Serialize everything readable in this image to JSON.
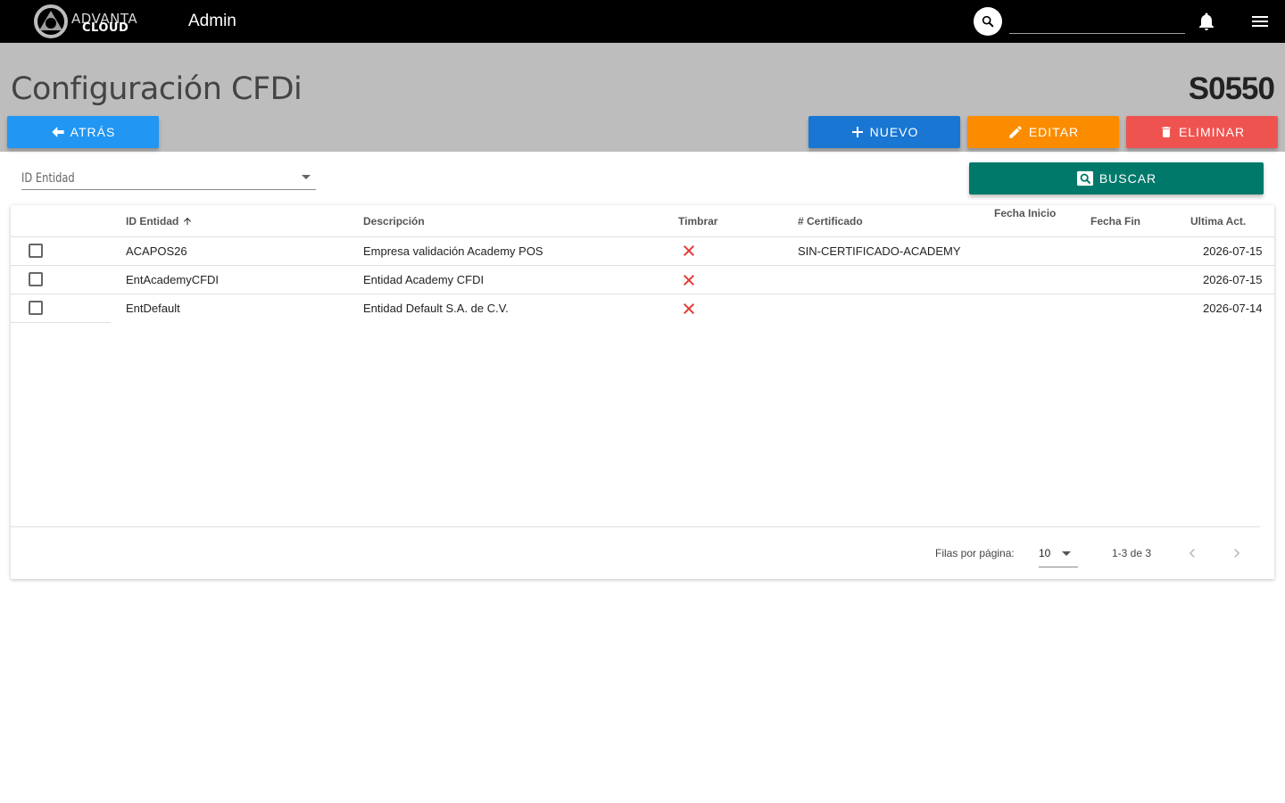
{
  "app": {
    "logo_line1": "ADVANTA",
    "logo_line2": "CLOUD",
    "section": "Admin",
    "search_placeholder": "",
    "icons": {
      "search": "search-icon",
      "notifications": "bell-icon",
      "menu": "menu-icon"
    }
  },
  "page": {
    "title": "Configuración CFDi",
    "code": "S0550"
  },
  "toolbar": {
    "back_label": "ATRÁS",
    "new_label": "NUEVO",
    "edit_label": "EDITAR",
    "delete_label": "ELIMINAR",
    "search_label": "BUSCAR",
    "colors": {
      "back": "#2196f3",
      "new": "#1976d2",
      "edit": "#fb8c00",
      "delete": "#ef5350",
      "search": "#00796b"
    }
  },
  "filter": {
    "label": "ID Entidad",
    "value": ""
  },
  "table": {
    "columns": [
      "ID Entidad",
      "Descripción",
      "Timbrar",
      "# Certificado",
      "Fecha Inicio",
      "Fecha Fin",
      "Ultima Act."
    ],
    "sort": {
      "column": "ID Entidad",
      "direction": "ascending"
    },
    "rows": [
      {
        "id": "ACAPOS26",
        "descripcion": "Empresa validación Academy POS",
        "timbrar": false,
        "certificado": "SIN-CERTIFICADO-ACADEMY",
        "fecha_inicio": "",
        "fecha_fin": "",
        "ultima_act": "2026-07-15"
      },
      {
        "id": "EntAcademyCFDI",
        "descripcion": "Entidad Academy CFDI",
        "timbrar": false,
        "certificado": "",
        "fecha_inicio": "",
        "fecha_fin": "",
        "ultima_act": "2026-07-15"
      },
      {
        "id": "EntDefault",
        "descripcion": "Entidad Default S.A. de C.V.",
        "timbrar": false,
        "certificado": "",
        "fecha_inicio": "",
        "fecha_fin": "",
        "ultima_act": "2026-07-14"
      }
    ]
  },
  "pagination": {
    "rows_per_page_label": "Filas por página:",
    "rows_per_page": "10",
    "range": "1-3 de 3"
  }
}
